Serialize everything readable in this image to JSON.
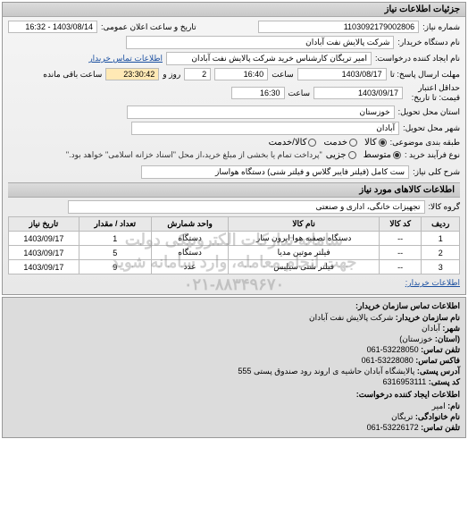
{
  "panel": {
    "title": "جزئیات اطلاعات نیاز"
  },
  "fields": {
    "need_no_label": "شماره نیاز:",
    "need_no": "1103092179002806",
    "public_date_label": "تاریخ و ساعت اعلان عمومی:",
    "public_date": "1403/08/14 - 16:32",
    "buyer_label": "نام دستگاه خریدار:",
    "buyer": "شرکت پالایش نفت آبادان",
    "requester_label": "نام ایجاد کننده درخواست:",
    "requester": "امیر تریگان کارشناس خرید شرکت پالایش نفت آبادان",
    "buyer_contact_link": "اطلاعات تماس خریدار",
    "deadline_label": "مهلت ارسال پاسخ: تا",
    "deadline_date": "1403/08/17",
    "deadline_time_label": "ساعت",
    "deadline_time": "16:40",
    "remain_days": "2",
    "remain_days_label": "روز و",
    "remain_time": "23:30:42",
    "remain_time_label": "ساعت باقی مانده",
    "price_validity_label": "حداقل اعتبار\nقیمت: تا تاریخ:",
    "price_validity_date": "1403/09/17",
    "price_validity_time_label": "ساعت",
    "price_validity_time": "16:30",
    "province_label": "استان محل تحویل:",
    "province": "خوزستان",
    "city_label": "شهر محل تحویل:",
    "city": "آبادان",
    "subject_group_label": "طبقه بندی موضوعی:",
    "radio_goods": "کالا",
    "radio_service": "خدمت",
    "radio_goods_service": "کالا/خدمت",
    "buy_type_label": "نوع فرآیند خرید :",
    "radio_medium": "متوسط",
    "radio_partial": "جزیی",
    "buy_note": "\"پرداخت تمام یا بخشی از مبلغ خرید،از محل \"اسناد خزانه اسلامی\" خواهد بود.\"",
    "need_title_label": "شرح کلی نیاز:",
    "need_title": "ست کامل (فیلتر فایبر گلاس و فیلتر شنی) دستگاه هواساز"
  },
  "section_items_title": "اطلاعات کالاهای مورد نیاز",
  "item_group_label": "گروه کالا:",
  "item_group": "تجهیزات خانگی، اداری و صنعتی",
  "table": {
    "headers": [
      "ردیف",
      "کد کالا",
      "نام کالا",
      "واحد شمارش",
      "تعداد / مقدار",
      "تاریخ نیاز"
    ],
    "rows": [
      [
        "1",
        "--",
        "دستگاه تصفیه هوا ایرون سار",
        "دستگاه",
        "1",
        "1403/09/17"
      ],
      [
        "2",
        "--",
        "فیلتر موتین مدیا",
        "دستگاه",
        "5",
        "1403/09/17"
      ],
      [
        "3",
        "--",
        "فیلتر شنی سیلیس",
        "عدد",
        "9",
        "1403/09/17"
      ]
    ]
  },
  "buyer_link_label": "اطلاعات خریدار:",
  "watermark": {
    "line1": "سامانه تدارکات الکترونیکی دولت",
    "line2": "جهت انجام معامله، وارد سامانه شوید",
    "line3": "۰۲۱-۸۸۳۴۹۶۷۰"
  },
  "footer": {
    "title": "اطلاعات تماس سازمان خریدار:",
    "org_label": "نام سازمان خریدار:",
    "org": "شرکت پالایش نفت آبادان",
    "city_label": "شهر:",
    "city": "آبادان",
    "province_label": "(استان:",
    "province": "خوزستان)",
    "phone_label": "تلفن تماس:",
    "phone": "53228050-061",
    "fax_label": "فاکس تماس:",
    "fax": "53228080-061",
    "post_addr_label": "آدرس پستی:",
    "post_addr": "پالایشگاه آبادان حاشیه ی اروند رود صندوق پستی 555",
    "post_code_label": "کد پستی:",
    "post_code": "6316953111",
    "req_creator_title": "اطلاعات ایجاد کننده درخواست:",
    "fname_label": "نام:",
    "fname": "امیر",
    "lname_label": "نام خانوادگی:",
    "lname": "تریگان",
    "req_phone_label": "تلفن تماس:",
    "req_phone": "53226172-061"
  }
}
